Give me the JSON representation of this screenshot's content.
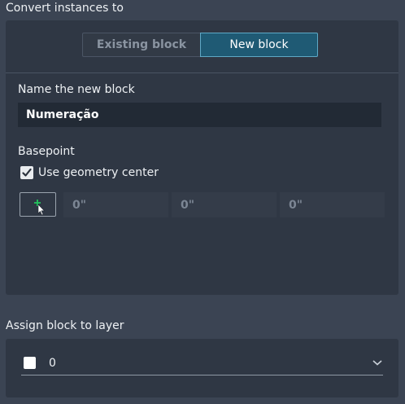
{
  "convert": {
    "title": "Convert instances to",
    "options": [
      "Existing block",
      "New block"
    ],
    "selected": "New block"
  },
  "new_block": {
    "name_label": "Name the new block",
    "name_value": "Numeração",
    "basepoint_label": "Basepoint",
    "use_center_label": "Use geometry center",
    "use_center_checked": true,
    "coords": [
      "0\"",
      "0\"",
      "0\""
    ]
  },
  "layer": {
    "title": "Assign block to layer",
    "value": "0",
    "swatch_color": "#ffffff"
  },
  "colors": {
    "accent": "#1f5a74",
    "accent_border": "#5fa8c6",
    "pick_plus": "#22c55e"
  },
  "icons": {
    "checkbox": "checkmark-icon",
    "pick": "pick-point-icon",
    "dropdown": "chevron-down-icon"
  }
}
